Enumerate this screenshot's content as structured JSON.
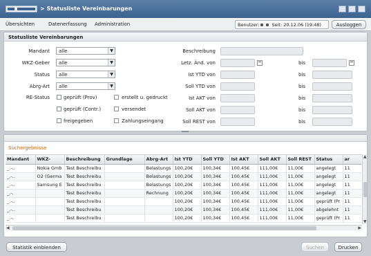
{
  "app": {
    "title": "> Statusliste Vereinbarungen"
  },
  "menu": [
    "Übersichten",
    "Datenerfassung",
    "Administration"
  ],
  "user": {
    "label": "Benutzer:",
    "session": "Seit: 20.12.06 (19:48)"
  },
  "logout_label": "Ausloggen",
  "filter": {
    "title": "Statusliste Vereinbarungen",
    "left": [
      {
        "label": "Mandant",
        "value": "alle"
      },
      {
        "label": "WKZ-Geber",
        "value": "alle"
      },
      {
        "label": "Status",
        "value": "alle"
      },
      {
        "label": "Abrg-Art",
        "value": "alle"
      }
    ],
    "re_status_label": "RE-Status",
    "checkboxes": [
      "geprüft (Prov)",
      "erstellt u. gedruckt",
      "geprüft (Contr.)",
      "versendet",
      "freigegeben",
      "Zahlungseingang"
    ],
    "right": [
      "Beschreibung",
      "Letz. Änd. von",
      "Ist YTD von",
      "Soll YTD von",
      "Ist AKT von",
      "Soll AKT von",
      "Soll REST von"
    ],
    "bis": "bis"
  },
  "results": {
    "title": "Suchergebnisse",
    "columns": [
      "Mandant",
      "WKZ-",
      "Beschreibung",
      "Grundlage",
      "Abrg-Art",
      "Ist YTD",
      "Soll YTD",
      "Ist AKT",
      "Soll AKT",
      "Soll REST",
      "Status",
      "ar"
    ],
    "rows": [
      [
        "_.-..",
        "Nokia Gmb",
        "Test Beschreibu",
        "",
        "Belastungs",
        "100,20€",
        "100,34€",
        "100,45€",
        "111,00€",
        "11,00€",
        "angelegt",
        "11"
      ],
      [
        "_.-..",
        "O2 (Germa",
        "Test Beschreibu",
        "",
        "Belastungs",
        "100,20€",
        "100,34€",
        "100,45€",
        "111,00€",
        "11,00€",
        "angelegt",
        "11"
      ],
      [
        "_.-..",
        "Samsung E",
        "Test Beschreibu",
        "",
        "Belastungs",
        "100,20€",
        "100,34€",
        "100,45€",
        "111,00€",
        "11,00€",
        "angelegt",
        "11"
      ],
      [
        "_.-.",
        "",
        "Test Beschreibu",
        "",
        "Rechnung",
        "100,20€",
        "100,34€",
        "100,45€",
        "111,00€",
        "11,00€",
        "angelegt",
        "11"
      ],
      [
        "_.-..",
        "",
        "Test Beschreibu",
        "",
        "",
        "100,20€",
        "100,34€",
        "100,45€",
        "111,00€",
        "11,00€",
        "geprüft (Pr",
        "11"
      ],
      [
        "_.-..",
        "",
        "Test Beschreibu",
        "",
        "",
        "100,20€",
        "100,34€",
        "100,45€",
        "111,00€",
        "11,00€",
        "abgelehnt",
        "11"
      ],
      [
        "_.-.",
        "",
        "Test Beschreibu",
        "",
        "",
        "100,20€",
        "100,34€",
        "100,45€",
        "111,00€",
        "11,00€",
        "geprüft (Pr",
        "11"
      ]
    ]
  },
  "footer": {
    "stats_label": "Statistik einblenden",
    "search_label": "Suchen",
    "print_label": "Drucken"
  }
}
